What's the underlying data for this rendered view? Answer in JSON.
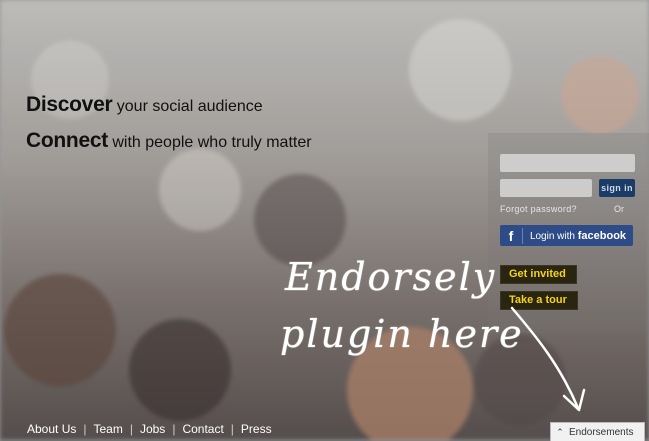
{
  "headline": {
    "line1_strong": "Discover",
    "line1_rest": "your social audience",
    "line2_strong": "Connect",
    "line2_rest": "with people who truly matter"
  },
  "login": {
    "email_placeholder": "",
    "password_placeholder": "",
    "signin_label": "sign in",
    "forgot_label": "Forgot password?",
    "or_label": "Or",
    "facebook_label_prefix": "Login with",
    "facebook_label_brand": "facebook"
  },
  "actions": {
    "get_invited_label": "Get invited",
    "take_tour_label": "Take a tour"
  },
  "annotation": {
    "line1": "Endorsely",
    "line2": "plugin here"
  },
  "footer": {
    "links": [
      "About Us",
      "Team",
      "Jobs",
      "Contact",
      "Press"
    ]
  },
  "endorsements_tab": {
    "label": "Endorsements"
  },
  "colors": {
    "signin_bg": "#1b3c66",
    "facebook_bg": "#2d4b87",
    "yellow_text": "#f4d21e"
  }
}
